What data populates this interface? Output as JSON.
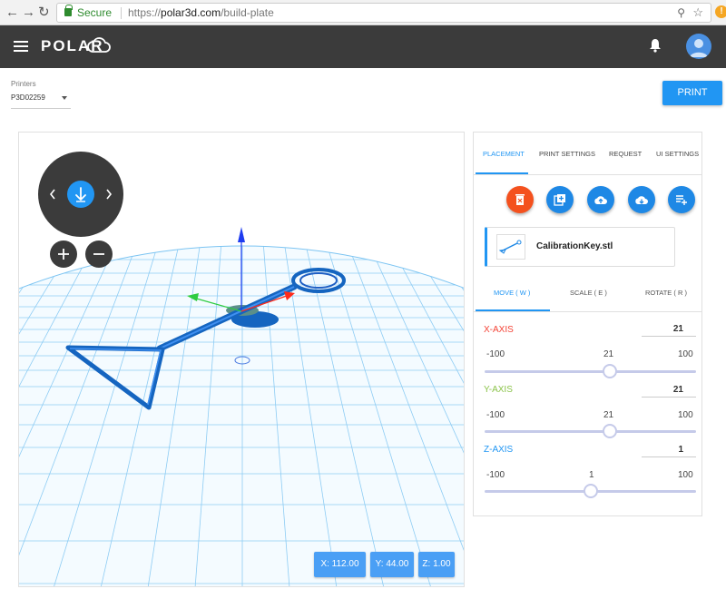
{
  "browser": {
    "secure_label": "Secure",
    "url_scheme": "https://",
    "url_host": "polar3d.com",
    "url_path": "/build-plate"
  },
  "header": {
    "logo_text": "POLAR",
    "accent_color": "#2196f3"
  },
  "printer": {
    "label": "Printers",
    "selected": "P3D02259"
  },
  "print_button": "PRINT",
  "viewport": {
    "coords": [
      "X: 112.00",
      "Y: 44.00",
      "Z: 1.00"
    ]
  },
  "panel": {
    "tabs": [
      "PLACEMENT",
      "PRINT SETTINGS",
      "REQUEST",
      "UI SETTINGS"
    ],
    "actions": [
      {
        "icon": "delete-icon",
        "color": "#f4511e"
      },
      {
        "icon": "duplicate-icon",
        "color": "#1e88e5"
      },
      {
        "icon": "cloud-upload-icon",
        "color": "#1e88e5"
      },
      {
        "icon": "cloud-download-icon",
        "color": "#1e88e5"
      },
      {
        "icon": "playlist-add-icon",
        "color": "#1e88e5"
      }
    ],
    "file_name": "CalibrationKey.stl",
    "subtabs": [
      "MOVE ( W )",
      "SCALE ( E )",
      "ROTATE ( R )"
    ],
    "axes": [
      {
        "label": "X-AXIS",
        "color": "#f44336",
        "value": "21",
        "min": "-100",
        "mid": "21",
        "max": "100"
      },
      {
        "label": "Y-AXIS",
        "color": "#8bc34a",
        "value": "21",
        "min": "-100",
        "mid": "21",
        "max": "100"
      },
      {
        "label": "Z-AXIS",
        "color": "#2196f3",
        "value": "1",
        "min": "-100",
        "mid": "1",
        "max": "100"
      }
    ]
  }
}
